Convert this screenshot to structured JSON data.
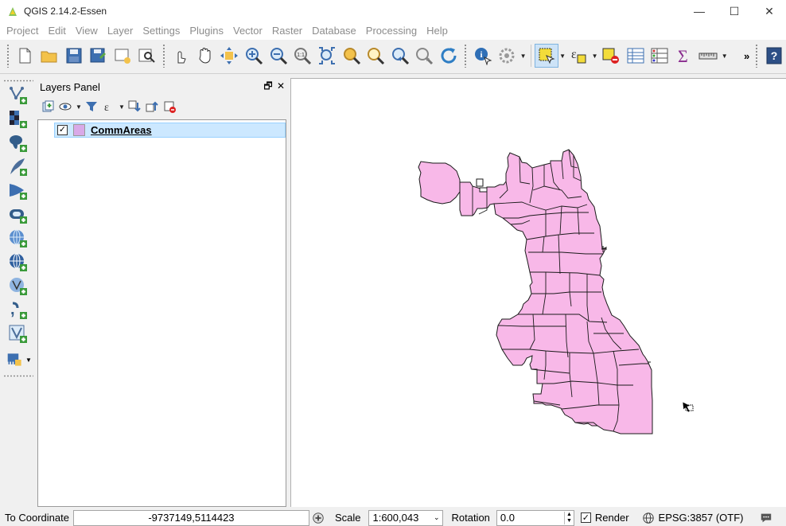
{
  "window": {
    "title": "QGIS 2.14.2-Essen",
    "controls": {
      "minimize": "—",
      "maximize": "☐",
      "close": "✕"
    }
  },
  "menubar": {
    "items": [
      "Project",
      "Edit",
      "View",
      "Layer",
      "Settings",
      "Plugins",
      "Vector",
      "Raster",
      "Database",
      "Processing",
      "Help"
    ]
  },
  "toolbar": {
    "buttons": [
      {
        "icon": "new-project-icon"
      },
      {
        "icon": "open-project-icon"
      },
      {
        "icon": "save-project-icon"
      },
      {
        "icon": "save-as-icon"
      },
      {
        "icon": "new-print-composer-icon"
      },
      {
        "icon": "composer-manager-icon"
      },
      {
        "icon": "touch-zoom-pan-icon"
      },
      {
        "icon": "pan-map-icon"
      },
      {
        "icon": "pan-to-selection-icon"
      },
      {
        "icon": "zoom-in-icon"
      },
      {
        "icon": "zoom-out-icon"
      },
      {
        "icon": "zoom-native-resolution-icon",
        "label": "1:1"
      },
      {
        "icon": "zoom-full-icon"
      },
      {
        "icon": "zoom-to-selection-icon"
      },
      {
        "icon": "zoom-to-layer-icon"
      },
      {
        "icon": "zoom-last-icon"
      },
      {
        "icon": "zoom-next-icon"
      },
      {
        "icon": "refresh-icon"
      },
      {
        "icon": "identify-features-icon"
      },
      {
        "icon": "run-feature-action-icon"
      },
      {
        "icon": "select-features-icon"
      },
      {
        "icon": "select-by-expression-icon"
      },
      {
        "icon": "deselect-all-icon"
      },
      {
        "icon": "open-attribute-table-icon"
      },
      {
        "icon": "field-calculator-icon"
      },
      {
        "icon": "statistical-summary-icon"
      },
      {
        "icon": "measure-line-icon"
      },
      {
        "icon": "help-icon"
      }
    ],
    "more": "»"
  },
  "vtoolbar": {
    "buttons": [
      "add-vector-layer-icon",
      "add-raster-layer-icon",
      "add-postgis-layer-icon",
      "add-spatialite-layer-icon",
      "add-mssql-layer-icon",
      "add-oracle-layer-icon",
      "add-wms-layer-icon",
      "add-wcs-layer-icon",
      "add-wfs-layer-icon",
      "add-delimited-text-layer-icon",
      "add-virtual-layer-icon",
      "new-shapefile-layer-icon"
    ]
  },
  "layers_panel": {
    "title": "Layers Panel",
    "float_button": "🗗",
    "close_button": "✕",
    "layers": [
      {
        "name": "CommAreas",
        "checked": true,
        "color": "#d9a9e8"
      }
    ]
  },
  "map": {
    "fill_color": "#f8b8e8",
    "stroke_color": "#1a1a1a"
  },
  "statusbar": {
    "coordinate_label": "To Coordinate",
    "coordinate_value": "-9737149,5114423",
    "scale_label": "Scale",
    "scale_value": "1:600,043",
    "rotation_label": "Rotation",
    "rotation_value": "0.0",
    "render_label": "Render",
    "render_checked": true,
    "crs_label": "EPSG:3857 (OTF)"
  }
}
